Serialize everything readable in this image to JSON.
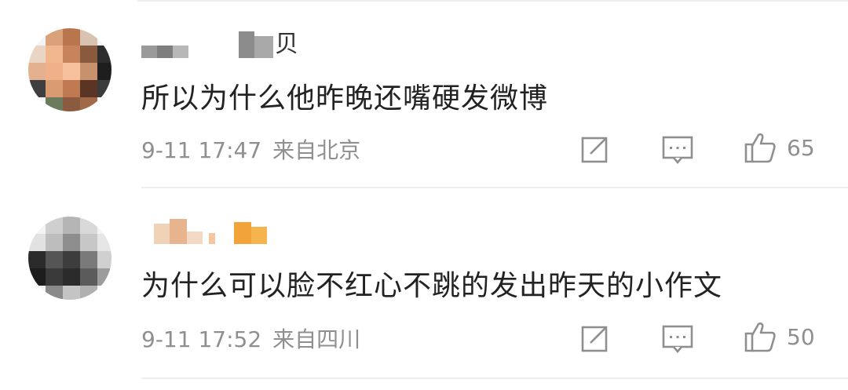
{
  "comments": [
    {
      "username_suffix": "贝",
      "text": "所以为什么他昨晚还嘴硬发微博",
      "time": "9-11 17:47",
      "location": "来自北京",
      "likes": "65",
      "actions": {
        "share_icon": "share-icon",
        "reply_icon": "comment-icon",
        "like_icon": "thumbs-up-icon"
      }
    },
    {
      "username_suffix": "",
      "text": "为什么可以脸不红心不跳的发出昨天的小作文",
      "time": "9-11 17:52",
      "location": "来自四川",
      "likes": "50",
      "actions": {
        "share_icon": "share-icon",
        "reply_icon": "comment-icon",
        "like_icon": "thumbs-up-icon"
      }
    }
  ],
  "colors": {
    "text_primary": "#222222",
    "text_secondary": "#8f8f8f",
    "divider": "#eeeeee",
    "username_badge": "#f2a33a"
  }
}
